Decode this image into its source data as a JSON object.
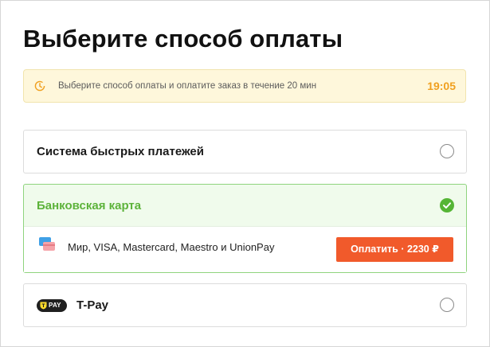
{
  "page": {
    "title": "Выберите способ оплаты"
  },
  "timer": {
    "message": "Выберите способ оплаты и оплатите заказ в течение 20 мин",
    "remaining": "19:05",
    "icon": "timer-icon",
    "accent_color": "#f0a01f"
  },
  "payment_options": {
    "sbp": {
      "label": "Система быстрых платежей",
      "selected": false
    },
    "card": {
      "label": "Банковская карта",
      "selected": true,
      "networks": "Мир, VISA, Mastercard, Maestro и UnionPay",
      "pay_button_label": "Оплатить · 2230 ₽",
      "accent_color": "#5db33b",
      "button_color": "#f15a2b"
    },
    "tpay": {
      "label": "T-Pay",
      "logo_text": "PAY",
      "selected": false
    }
  }
}
